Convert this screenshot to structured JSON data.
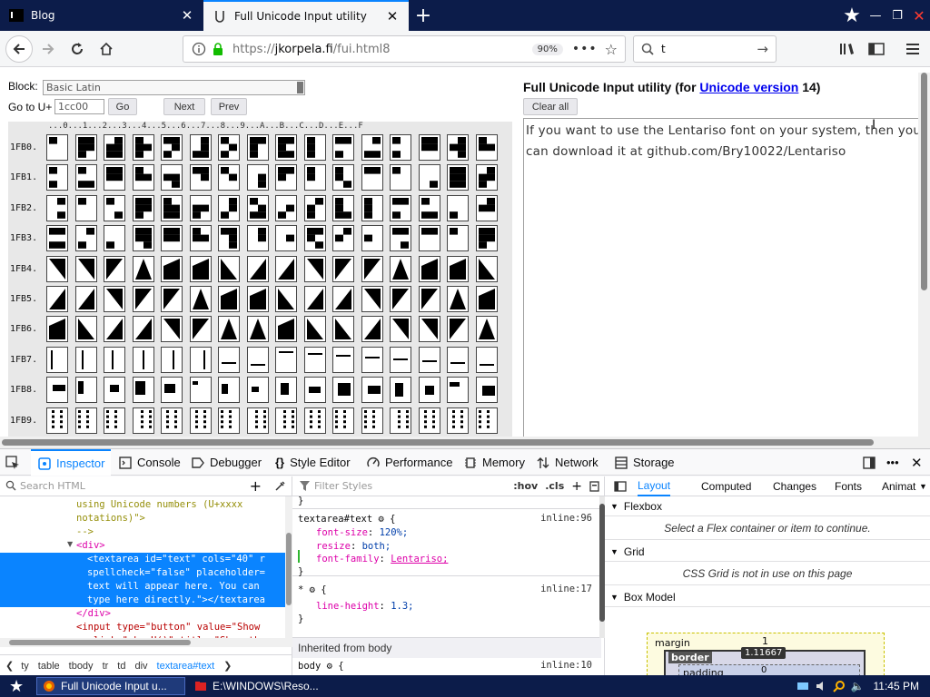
{
  "browser": {
    "tabs": [
      {
        "title": "Blog",
        "icon": "terminal-icon"
      },
      {
        "title": "Full Unicode Input utility",
        "icon": "unicode-icon"
      }
    ],
    "url_scheme": "https://",
    "url_domain": "jkorpela.fi",
    "url_path": "/fui.html8",
    "zoom": "90%",
    "search_value": "t"
  },
  "page": {
    "block_label": "Block:",
    "block_value": "Basic Latin",
    "goto_label": "Go to U+",
    "goto_value": "1cc00",
    "go_button": "Go",
    "next_button": "Next",
    "prev_button": "Prev",
    "header": "...0...1...2...3...4...5...6...7...8...9...A...B...C...D...E...F",
    "rows": [
      "1FB0.",
      "1FB1.",
      "1FB2.",
      "1FB3.",
      "1FB4.",
      "1FB5.",
      "1FB6.",
      "1FB7.",
      "1FB8.",
      "1FB9."
    ],
    "title_prefix": "Full Unicode Input utility (for ",
    "title_link": "Unicode version",
    "title_suffix": " 14)",
    "clear_button": "Clear all",
    "textarea_text": "If you want to use the Lentariso font on your system, then you can download it at github.com/Bry10022/Lentariso"
  },
  "devtools": {
    "tabs": [
      "Inspector",
      "Console",
      "Debugger",
      "Style Editor",
      "Performance",
      "Memory",
      "Network",
      "Storage"
    ],
    "search_html": "Search HTML",
    "html_lines": [
      {
        "text": "using Unicode numbers (U+xxxx",
        "cls": "cmt",
        "indent": 84
      },
      {
        "text": "notations)\">",
        "cls": "cmt",
        "indent": 84
      },
      {
        "text": "-->",
        "cls": "cmt",
        "indent": 84
      },
      {
        "text": "<div>",
        "cls": "tag",
        "indent": 84
      },
      {
        "text": "<textarea id=\"text\" cols=\"40\" r",
        "cls": "sel",
        "indent": 96
      },
      {
        "text": "spellcheck=\"false\" placeholder=",
        "cls": "sel",
        "indent": 96
      },
      {
        "text": "text will appear here. You can",
        "cls": "sel",
        "indent": 96
      },
      {
        "text": "type here directly.\"></textarea",
        "cls": "sel",
        "indent": 96
      },
      {
        "text": "</div>",
        "cls": "tag",
        "indent": 84
      },
      {
        "text": "<input type=\"button\" value=\"Show",
        "cls": "mix",
        "indent": 84
      },
      {
        "text": "onclick=\"showU()\" title=\"Show the",
        "cls": "mix",
        "indent": 84
      }
    ],
    "breadcrumbs": [
      "ty",
      "table",
      "tbody",
      "tr",
      "td",
      "div",
      "textarea#text"
    ],
    "filter_styles": "Filter Styles",
    "hov": ":hov",
    "cls": ".cls",
    "rule1_selector": "textarea#text",
    "rule1_source": "inline:96",
    "rule1_props": [
      {
        "name": "font-size",
        "value": "120%;"
      },
      {
        "name": "resize",
        "value": "both;"
      },
      {
        "name": "font-family",
        "value": "Lentariso;"
      }
    ],
    "rule2_selector": "*",
    "rule2_source": "inline:17",
    "rule2_props": [
      {
        "name": "line-height",
        "value": "1.3;"
      }
    ],
    "inherited": "Inherited from body",
    "rule3_selector": "body",
    "rule3_source": "inline:10",
    "layout_tabs": [
      "Layout",
      "Computed",
      "Changes",
      "Fonts",
      "Animat"
    ],
    "flexbox": "Flexbox",
    "flexbox_note": "Select a Flex container or item to continue.",
    "grid": "Grid",
    "grid_note": "CSS Grid is not in use on this page",
    "box_model": "Box Model",
    "bm_margin": "margin",
    "bm_margin_val": "1",
    "bm_border": "border",
    "bm_tip": "1.11667",
    "bm_padding": "padding",
    "bm_padding_val": "0"
  },
  "taskbar": {
    "tasks": [
      "Full Unicode Input u...",
      "E:\\WINDOWS\\Reso..."
    ],
    "clock": "11:45 PM"
  }
}
